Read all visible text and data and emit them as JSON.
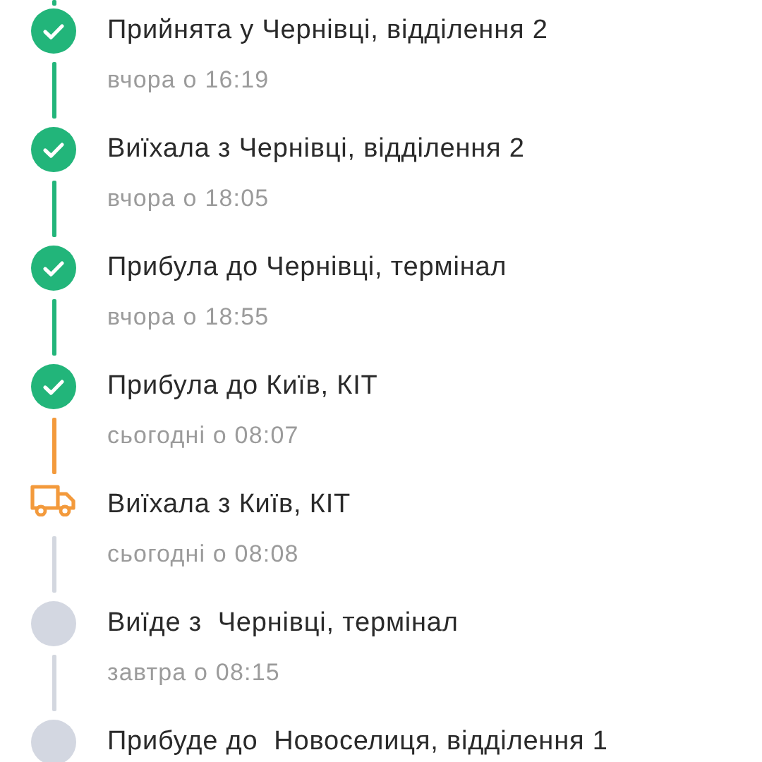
{
  "steps": [
    {
      "kind": "done",
      "title": "Прийнята у Чернівці, відділення 2",
      "time": "вчора о 16:19"
    },
    {
      "kind": "done",
      "title": "Виїхала з Чернівці, відділення 2",
      "time": "вчора о 18:05"
    },
    {
      "kind": "done",
      "title": "Прибула до Чернівці, термінал",
      "time": "вчора о 18:55"
    },
    {
      "kind": "done",
      "title": "Прибула до Київ, КІТ",
      "time": "сьогодні о 08:07"
    },
    {
      "kind": "transit",
      "title": "Виїхала з Київ, КІТ",
      "time": "сьогодні о 08:08"
    },
    {
      "kind": "pending",
      "title": "Виїде з  Чернівці, термінал",
      "time": "завтра о 08:15"
    },
    {
      "kind": "pending",
      "title": "Прибуде до  Новоселиця, відділення 1"
    }
  ]
}
